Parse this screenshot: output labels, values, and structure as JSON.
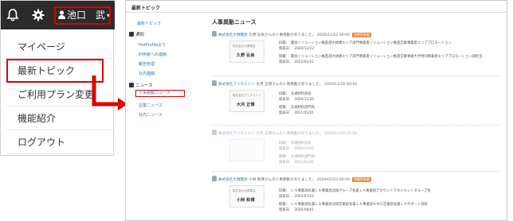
{
  "topbar": {
    "user_name": "池口　武",
    "caret": "▾",
    "icons": [
      "bell-icon",
      "gear-icon",
      "person-icon"
    ]
  },
  "menu": {
    "items": [
      {
        "label": "マイページ"
      },
      {
        "label": "最新トピック",
        "active": true
      },
      {
        "label": "ご利用プラン変更"
      },
      {
        "label": "機能紹介"
      },
      {
        "label": "ログアウト"
      }
    ]
  },
  "colors": {
    "highlight": "#e00000",
    "link": "#3973b8",
    "badge": "#f08a3c",
    "topbar": "#2b2b2b"
  },
  "page": {
    "title": "最新トピック",
    "section_title": "人事異動ニュース"
  },
  "sidenav": {
    "latest": "最新トピック",
    "notice_head": "通知",
    "notice_items": [
      "HotProfileより",
      "利用者への連絡",
      "報告管理",
      "社内連絡"
    ],
    "news_head": "ニュース",
    "news_items": [
      "人事異動ニュース",
      "企業ニュース",
      "社内ニュース"
    ]
  },
  "news": [
    {
      "company": "株式会社大輝電会",
      "person": "久野 弘尚",
      "text": "さんの人事異動がありました。",
      "date": "2020/12/22 00:00",
      "badge": "名刺所有者",
      "card_company": "株式会社大輝電会",
      "card_name": "久野 弘尚",
      "old": "旧職：　電会ソリューション推進部大規模エリア部門事業者ソリューション推進営業事業者エリアプロモーション",
      "old_date": "発表日：　2020/12/22",
      "new": "新職：　電会ソリューション推進部大規模エリア部門事業者ソリューション推進営業事業大手特別事業者エリアプロモーション部担当",
      "new_date": "発表日：　2021/01/01"
    },
    {
      "company": "株式会社ブリヂストン",
      "person": "大月 正博",
      "text": "さんの人事異動がありました。",
      "date": "2020/11/20 00:00",
      "badge": "",
      "card_company": "株式会社ブリヂストン",
      "card_name": "大月 正博",
      "old": "旧職：　先端材料部長",
      "old_date": "発表日：　2020/11/20",
      "new": "新職：　先端材料部門長",
      "new_date": "発表日：　2021/01/01"
    },
    {
      "company": "株式会社ブリヂストン",
      "person": "大月 正博",
      "text": "さんの人事異動がありました。",
      "date": "2020/11/20 00:00",
      "badge": "",
      "card_company": "",
      "card_name": "",
      "old": "旧職：　先端材料部長",
      "old_date": "発表日：　2020/11/20",
      "new": "新職：　先端材料部門長",
      "new_date": "発表日：　2021/01/01"
    },
    {
      "company": "株式会社大輝電会",
      "person": "小林 和博",
      "text": "さんの人事異動がありました。",
      "date": "2020/07/22 00:00",
      "badge": "名刺所有者",
      "card_company": "株式会社大輝電会",
      "card_name": "小林 和博",
      "old": "旧職：　ＬＡ事業部長兼ＬＡ事業部北域グループ長兼ＬＡ事業部アカウントマネジメントグループ長",
      "old_date": "発表日：　2020/07/22",
      "new": "新職：　ＬＡ事業部長兼ＬＡ事業部北域営業部長兼ＬＡ事業部ＡＭＧ営業部長兼ＬＡサポート部長",
      "new_date": "発表日：　2020/08/01"
    }
  ]
}
